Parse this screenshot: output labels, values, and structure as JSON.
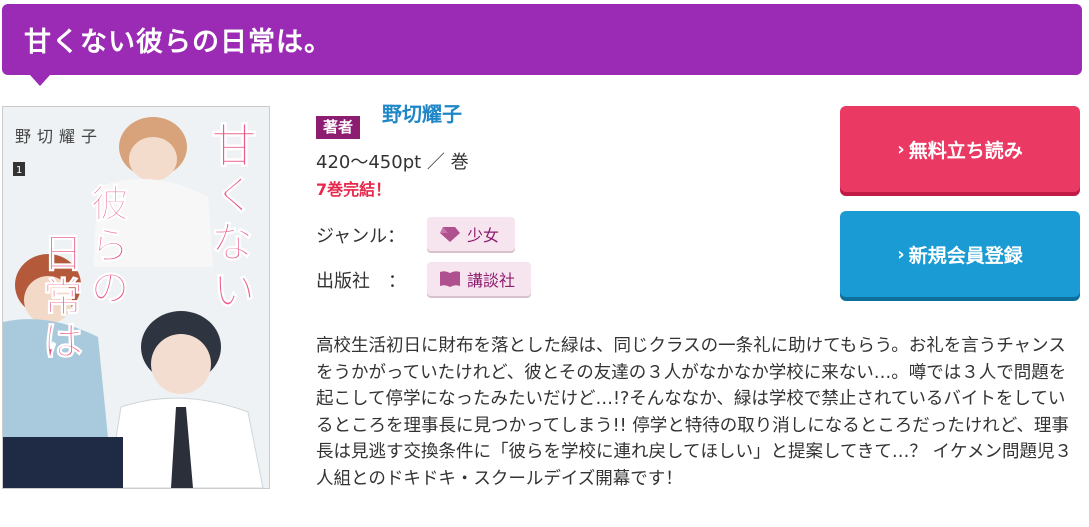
{
  "header": {
    "title": "甘くない彼らの日常は。"
  },
  "cover": {
    "title_vertical": [
      "甘",
      "く",
      "な",
      "い",
      "彼",
      "ら",
      "の",
      "日",
      "常",
      "は",
      "。"
    ],
    "author_vertical": "野切耀子",
    "volume": "1"
  },
  "info": {
    "author_badge": "著者",
    "author_name": "野切耀子",
    "price": "420〜450pt ／ 巻",
    "status": "7巻完結！",
    "genre_label": "ジャンル：",
    "genre_value": "少女",
    "publisher_label": "出版社　：",
    "publisher_value": "講談社"
  },
  "buttons": {
    "free_read": "無料立ち読み",
    "register": "新規会員登録"
  },
  "description": "高校生活初日に財布を落とした緑は、同じクラスの一条礼に助けてもらう。お礼を言うチャンスをうかがっていたけれど、彼とその友達の３人がなかなか学校に来ない…。噂では３人で問題を起こして停学になったみたいだけど…!?そんななか、緑は学校で禁止されているバイトをしているところを理事長に見つかってしまう!! 停学と特待の取り消しになるところだったけれど、理事長は見逃す交換条件に「彼らを学校に連れ戻してほしい」と提案してきて…？ イケメン問題児３人組とのドキドキ・スクールデイズ開幕です！",
  "colors": {
    "header_bg": "#9b2bb5",
    "author_badge_bg": "#8d1d70",
    "author_name": "#1f87c7",
    "status_text": "#e6284a",
    "free_read_bg": "#ea3a63",
    "register_bg": "#1a9bd3",
    "tag_bg": "#f6e5ef"
  },
  "icons": {
    "genre": "gem-icon",
    "publisher": "book-icon",
    "button_chevron": "chevron-right-icon"
  }
}
